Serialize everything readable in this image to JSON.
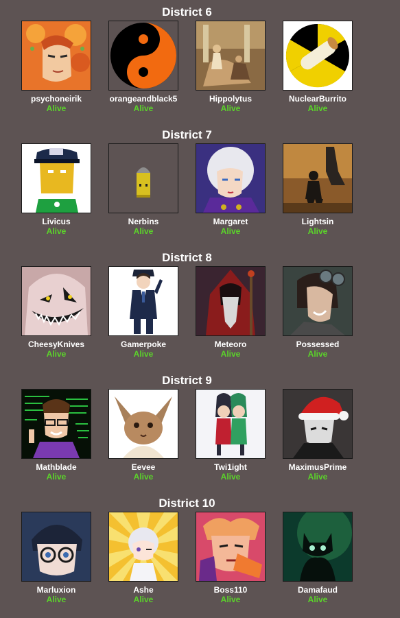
{
  "districts": [
    {
      "title": "District 6",
      "tributes": [
        {
          "name": "psychoneirik",
          "status": "Alive",
          "avatar_icon": "anime-orange-hair-avatar-icon"
        },
        {
          "name": "orangeandblack5",
          "status": "Alive",
          "avatar_icon": "yin-yang-avatar-icon"
        },
        {
          "name": "Hippolytus",
          "status": "Alive",
          "avatar_icon": "classical-painting-avatar-icon"
        },
        {
          "name": "NuclearBurrito",
          "status": "Alive",
          "avatar_icon": "nuclear-burrito-avatar-icon"
        }
      ]
    },
    {
      "title": "District 7",
      "tributes": [
        {
          "name": "Livicus",
          "status": "Alive",
          "avatar_icon": "police-cartoon-avatar-icon"
        },
        {
          "name": "Nerbins",
          "status": "Alive",
          "avatar_icon": "bullet-sprite-avatar-icon"
        },
        {
          "name": "Margaret",
          "status": "Alive",
          "avatar_icon": "white-hair-anime-avatar-icon"
        },
        {
          "name": "Lightsin",
          "status": "Alive",
          "avatar_icon": "mech-soldier-avatar-icon"
        }
      ]
    },
    {
      "title": "District 8",
      "tributes": [
        {
          "name": "CheesyKnives",
          "status": "Alive",
          "avatar_icon": "grinning-creature-avatar-icon"
        },
        {
          "name": "Gamerpoke",
          "status": "Alive",
          "avatar_icon": "suited-anime-avatar-icon"
        },
        {
          "name": "Meteoro",
          "status": "Alive",
          "avatar_icon": "red-wizard-avatar-icon"
        },
        {
          "name": "Possessed",
          "status": "Alive",
          "avatar_icon": "goggles-woman-avatar-icon"
        }
      ]
    },
    {
      "title": "District 9",
      "tributes": [
        {
          "name": "Mathblade",
          "status": "Alive",
          "avatar_icon": "code-boy-avatar-icon"
        },
        {
          "name": "Eevee",
          "status": "Alive",
          "avatar_icon": "eevee-avatar-icon"
        },
        {
          "name": "Twi1ight",
          "status": "Alive",
          "avatar_icon": "splatoon-avatar-icon"
        },
        {
          "name": "MaximusPrime",
          "status": "Alive",
          "avatar_icon": "santa-hat-avatar-icon"
        }
      ]
    },
    {
      "title": "District 10",
      "tributes": [
        {
          "name": "Marluxion",
          "status": "Alive",
          "avatar_icon": "glasses-boy-avatar-icon"
        },
        {
          "name": "Ashe",
          "status": "Alive",
          "avatar_icon": "chibi-sunburst-avatar-icon"
        },
        {
          "name": "Boss110",
          "status": "Alive",
          "avatar_icon": "jojo-avatar-icon"
        },
        {
          "name": "Damafaud",
          "status": "Alive",
          "avatar_icon": "glowing-cat-avatar-icon"
        }
      ]
    }
  ]
}
